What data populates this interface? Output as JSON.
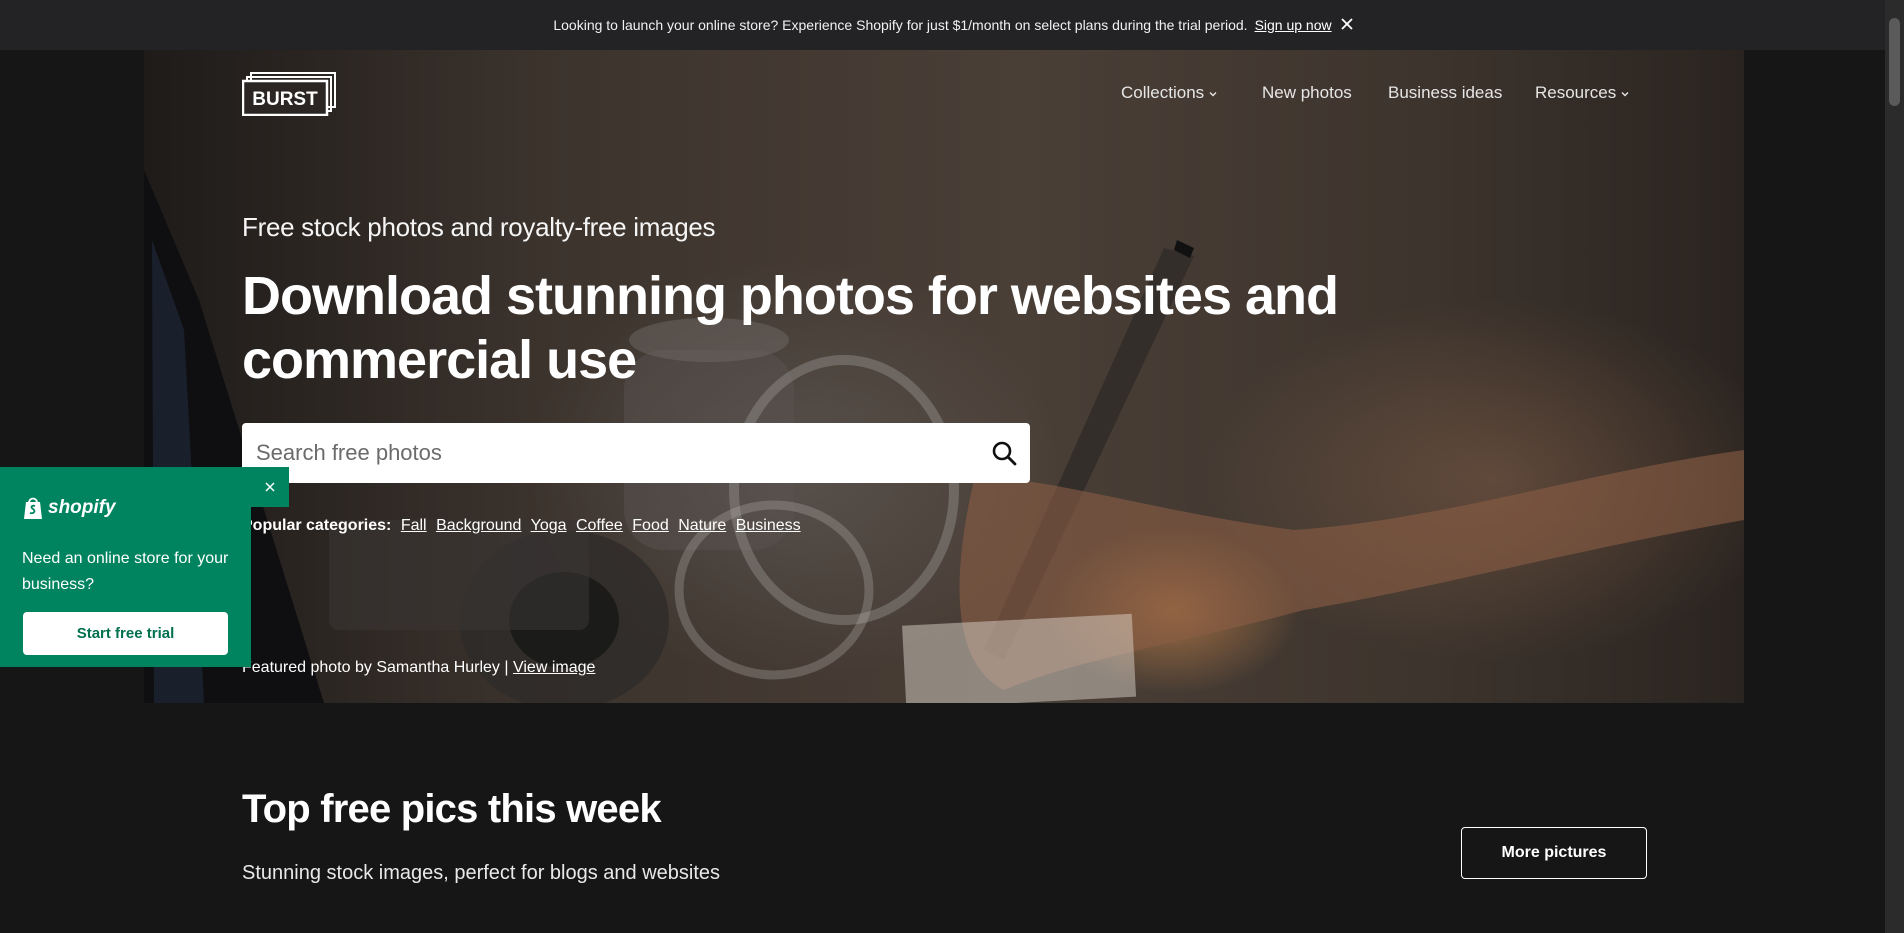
{
  "banner": {
    "text": "Looking to launch your online store? Experience Shopify for just $1/month on select plans during the trial period.",
    "link": "Sign up now",
    "close_icon": "close-icon"
  },
  "header": {
    "logo": "BURST",
    "nav": [
      {
        "label": "Collections",
        "has_dropdown": true
      },
      {
        "label": "New photos",
        "has_dropdown": false
      },
      {
        "label": "Business ideas",
        "has_dropdown": false
      },
      {
        "label": "Resources",
        "has_dropdown": true
      }
    ]
  },
  "hero": {
    "eyebrow": "Free stock photos and royalty-free images",
    "headline": "Download stunning photos for websites and commercial use",
    "search_placeholder": "Search free photos",
    "categories_label": "Popular categories:",
    "categories": [
      "Fall",
      "Background",
      "Yoga",
      "Coffee",
      "Food",
      "Nature",
      "Business"
    ],
    "credit_text": "Featured photo by Samantha Hurley |",
    "credit_link": "View image"
  },
  "popup": {
    "brand": "shopify",
    "message": "Need an online store for your business?",
    "button": "Start free trial",
    "accent": "#00845f"
  },
  "section": {
    "title": "Top free pics this week",
    "subtitle": "Stunning stock images, perfect for blogs and websites",
    "button": "More pictures"
  },
  "colors": {
    "page_bg": "#161616",
    "banner_bg": "#232325",
    "popup_green": "#00845f"
  }
}
